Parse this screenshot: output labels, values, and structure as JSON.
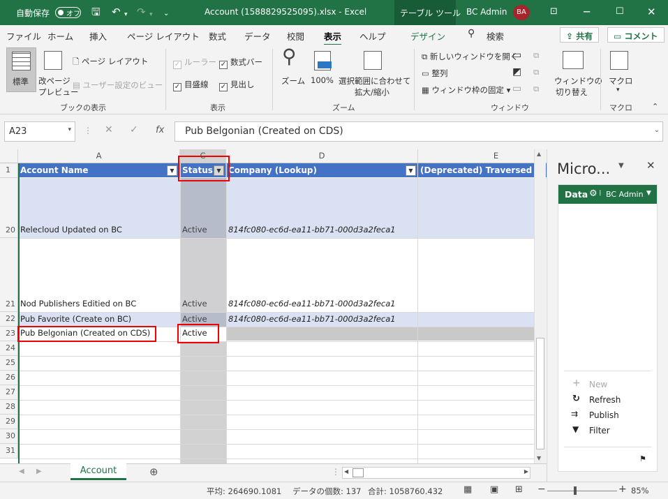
{
  "titlebar": {
    "autosave_label": "自動保存",
    "autosave_state": "オフ",
    "filename": "Account (1588829525095).xlsx  -  Excel",
    "context_tab": "テーブル ツール",
    "user_name": "BC Admin",
    "user_initials": "BA"
  },
  "menu": {
    "tabs": [
      "ファイル",
      "ホーム",
      "挿入",
      "ページ レイアウト",
      "数式",
      "データ",
      "校閲",
      "表示",
      "ヘルプ",
      "デザイン"
    ],
    "search": "検索",
    "share": "共有",
    "comment": "コメント"
  },
  "ribbon": {
    "normal": "標準",
    "page_break_1": "改ページ",
    "page_break_2": "プレビュー",
    "page_layout": "ページ レイアウト",
    "custom_view": "ユーザー設定のビュー",
    "group_views": "ブックの表示",
    "ruler": "ルーラー",
    "formula_bar": "数式バー",
    "gridlines": "目盛線",
    "headings": "見出し",
    "group_show": "表示",
    "zoom": "ズーム",
    "zoom100": "100%",
    "zoom_sel_1": "選択範囲に合わせて",
    "zoom_sel_2": "拡大/縮小",
    "group_zoom": "ズーム",
    "new_window": "新しいウィンドウを開く",
    "arrange": "整列",
    "freeze": "ウィンドウ枠の固定",
    "switch_1": "ウィンドウの",
    "switch_2": "切り替え",
    "group_window": "ウィンドウ",
    "macro": "マクロ",
    "group_macro": "マクロ"
  },
  "formula": {
    "cell_ref": "A23",
    "content": "Pub Belgonian (Created on CDS)"
  },
  "grid": {
    "columns": [
      "A",
      "C",
      "D",
      "E"
    ],
    "headers": [
      "Account Name",
      "Status",
      "Company (Lookup)",
      "(Deprecated) Traversed Pat"
    ],
    "rows": [
      {
        "num": "1"
      },
      {
        "num": "20",
        "a": "Relecloud Updated on BC",
        "c": "Active",
        "d": "814fc080-ec6d-ea11-bb71-000d3a2feca1"
      },
      {
        "num": "21",
        "a": "Nod Publishers Editied on BC",
        "c": "Active",
        "d": "814fc080-ec6d-ea11-bb71-000d3a2feca1"
      },
      {
        "num": "22",
        "a": "Pub Favorite (Create on BC)",
        "c": "Active",
        "d": "814fc080-ec6d-ea11-bb71-000d3a2feca1"
      },
      {
        "num": "23",
        "a": "Pub Belgonian (Created on CDS)",
        "c": "Active",
        "d": ""
      },
      {
        "num": "24"
      },
      {
        "num": "25"
      },
      {
        "num": "26"
      },
      {
        "num": "27"
      },
      {
        "num": "28"
      },
      {
        "num": "29"
      },
      {
        "num": "30"
      },
      {
        "num": "31"
      }
    ]
  },
  "sheet_tab": "Account",
  "status": {
    "average": "平均: 264690.1081",
    "count": "データの個数: 137",
    "sum": "合計: 1058760.432",
    "zoom": "85%"
  },
  "pane": {
    "title": "Micro...",
    "data_tab": "Data",
    "user": "BC Admin",
    "new": "New",
    "refresh": "Refresh",
    "publish": "Publish",
    "filter": "Filter"
  }
}
